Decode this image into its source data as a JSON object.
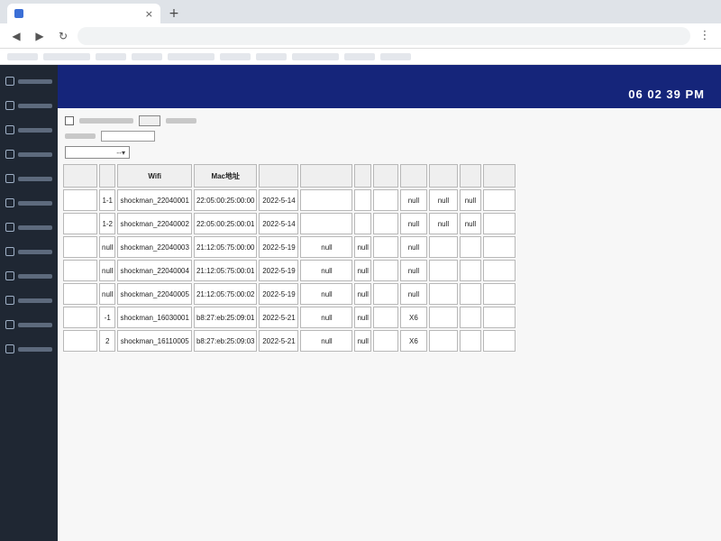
{
  "browser": {
    "address_url": "",
    "new_tab_label": "+",
    "tab_close_label": "×"
  },
  "header": {
    "clock": "06 02 39 PM"
  },
  "toolbar_controls": {
    "dropdown_caret": "--▾"
  },
  "table": {
    "columns": [
      "",
      "",
      "Wifi",
      "Mac地址",
      "",
      "",
      "",
      "",
      "",
      "",
      "",
      ""
    ],
    "rows": [
      [
        "",
        "1-1",
        "shockman_22040001",
        "22:05:00:25:00:00",
        "2022-5-14",
        "",
        "",
        "",
        "null",
        "null",
        "null",
        ""
      ],
      [
        "",
        "1-2",
        "shockman_22040002",
        "22:05:00:25:00:01",
        "2022-5-14",
        "",
        "",
        "",
        "null",
        "null",
        "null",
        ""
      ],
      [
        "",
        "null",
        "shockman_22040003",
        "21:12:05:75:00:00",
        "2022-5-19",
        "null",
        "null",
        "",
        "null",
        "",
        "",
        ""
      ],
      [
        "",
        "null",
        "shockman_22040004",
        "21:12:05:75:00:01",
        "2022-5-19",
        "null",
        "null",
        "",
        "null",
        "",
        "",
        ""
      ],
      [
        "",
        "null",
        "shockman_22040005",
        "21:12:05:75:00:02",
        "2022-5-19",
        "null",
        "null",
        "",
        "null",
        "",
        "",
        ""
      ],
      [
        "",
        "-1",
        "shockman_16030001",
        "b8:27:eb:25:09:01",
        "2022-5-21",
        "null",
        "null",
        "",
        "X6",
        "",
        "",
        ""
      ],
      [
        "",
        "2",
        "shockman_16110005",
        "b8:27:eb:25:09:03",
        "2022-5-21",
        "null",
        "null",
        "",
        "X6",
        "",
        "",
        ""
      ]
    ]
  },
  "colors": {
    "header_bg": "#15257a",
    "sidebar_bg": "#1f2733",
    "tab_favicon": "#3b6fd6"
  },
  "icons": {
    "back": "back-arrow-icon",
    "forward": "forward-arrow-icon",
    "reload": "reload-icon",
    "menu": "more-menu-icon",
    "sidebar_item": "nav-item-icon"
  }
}
